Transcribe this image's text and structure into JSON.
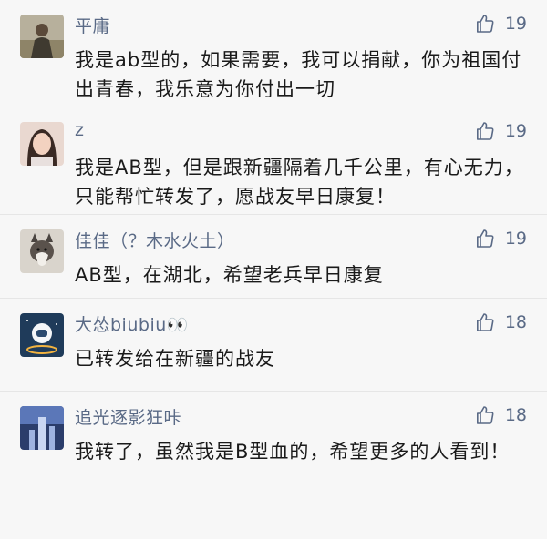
{
  "comments": [
    {
      "name": "平庸",
      "likes": "19",
      "text": "我是ab型的，如果需要，我可以捐献，你为祖国付出青春，我乐意为你付出一切"
    },
    {
      "name": "z",
      "likes": "19",
      "text": "我是AB型，但是跟新疆隔着几千公里，有心无力，只能帮忙转发了，愿战友早日康复！"
    },
    {
      "name": "佳佳（？木水火土）",
      "likes": "19",
      "text": "AB型，在湖北，希望老兵早日康复"
    },
    {
      "name": "大怂biubiu👀",
      "likes": "18",
      "text": "已转发给在新疆的战友"
    },
    {
      "name": "追光逐影狂咔",
      "likes": "18",
      "text": "我转了，虽然我是B型血的，希望更多的人看到！"
    }
  ],
  "colors": {
    "name": "#5a6a86",
    "text": "#1a1a1a",
    "background": "#f7f7f7"
  },
  "icons": {
    "like": "thumbs-up-icon"
  }
}
